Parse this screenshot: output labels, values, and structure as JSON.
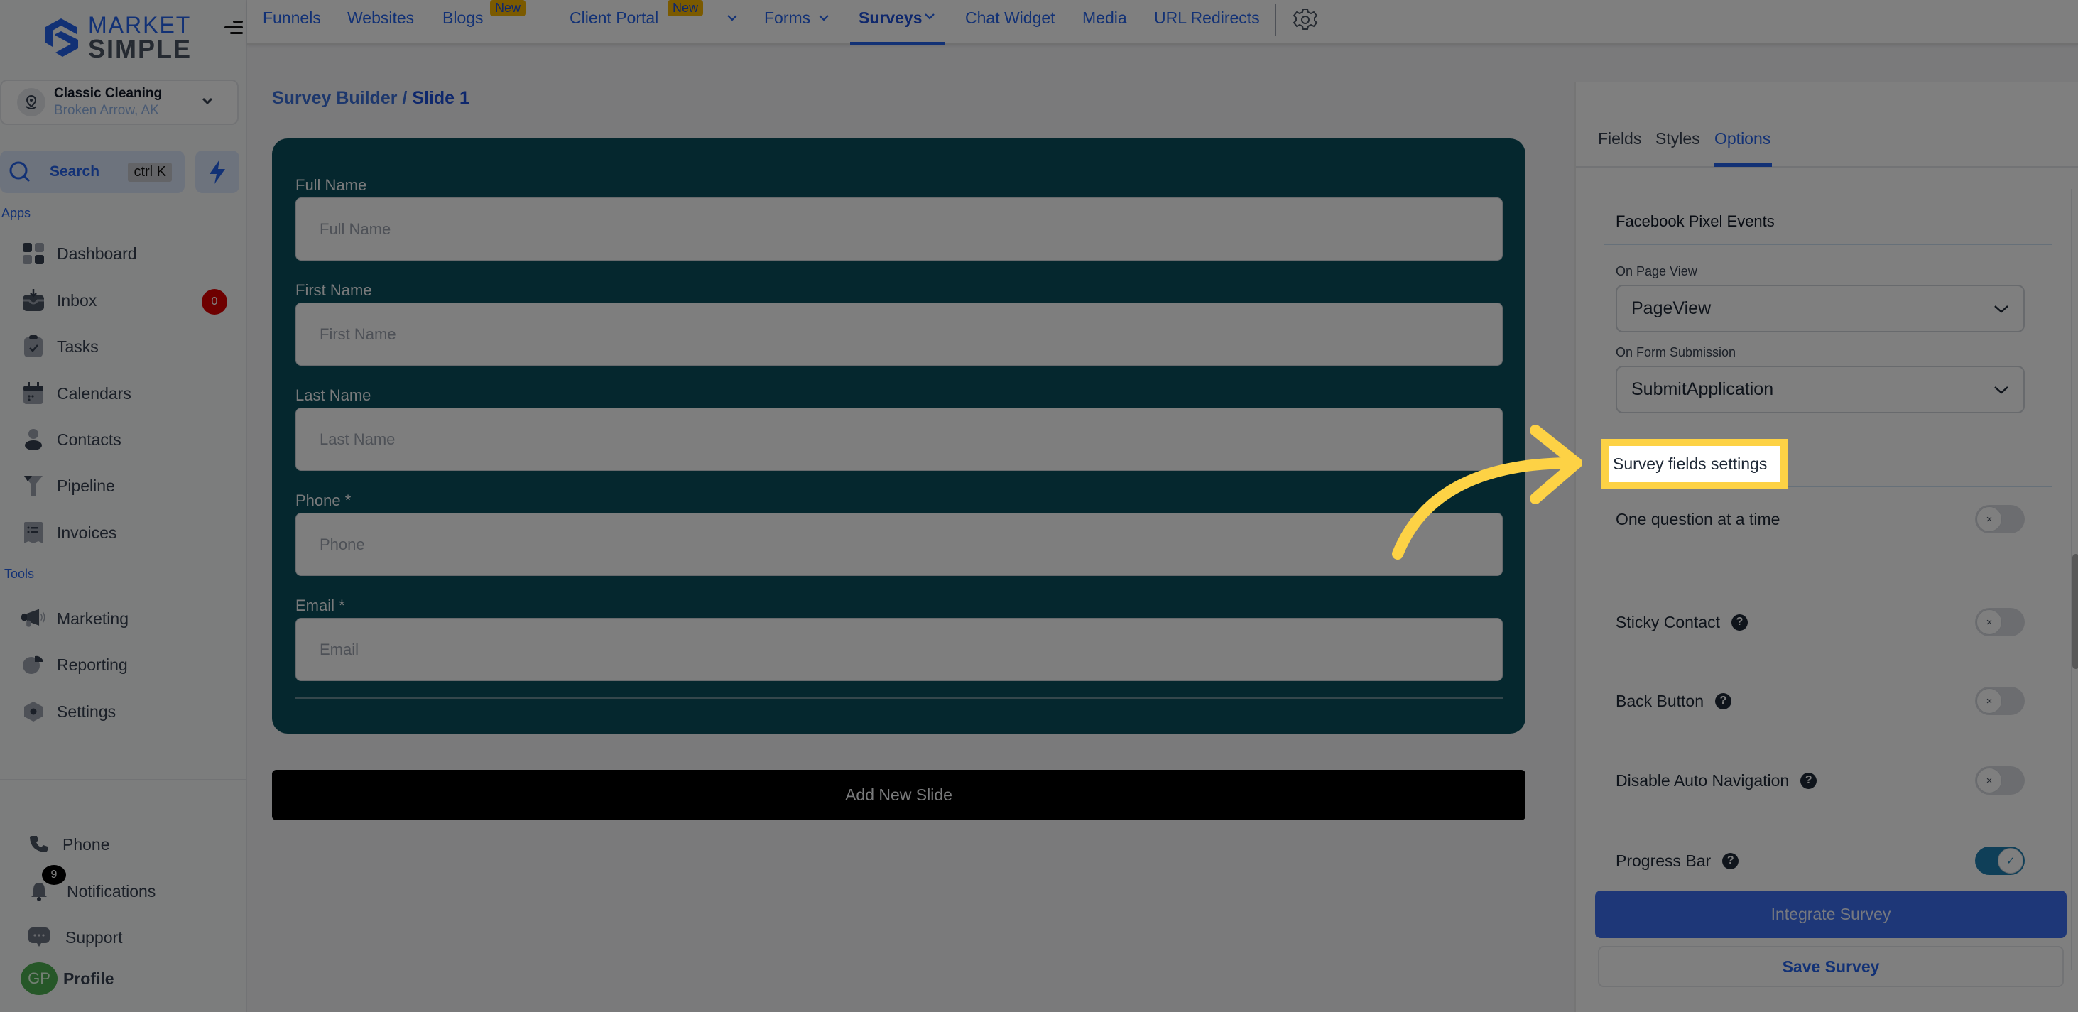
{
  "brand": {
    "line1": "MARKET",
    "line2": "SIMPLE",
    "accent": "#2563eb"
  },
  "location": {
    "name": "Classic Cleaning",
    "subtitle": "Broken Arrow, AK"
  },
  "search": {
    "label": "Search",
    "shortcut": "ctrl K"
  },
  "sidebar": {
    "apps_label": "Apps",
    "tools_label": "Tools",
    "apps": [
      {
        "label": "Dashboard",
        "icon": "dashboard-icon"
      },
      {
        "label": "Inbox",
        "icon": "inbox-icon",
        "badge": "0"
      },
      {
        "label": "Tasks",
        "icon": "tasks-icon"
      },
      {
        "label": "Calendars",
        "icon": "calendar-icon"
      },
      {
        "label": "Contacts",
        "icon": "contacts-icon"
      },
      {
        "label": "Pipeline",
        "icon": "pipeline-icon"
      },
      {
        "label": "Invoices",
        "icon": "invoices-icon"
      }
    ],
    "tools": [
      {
        "label": "Marketing",
        "icon": "megaphone-icon"
      },
      {
        "label": "Reporting",
        "icon": "pie-chart-icon"
      },
      {
        "label": "Settings",
        "icon": "settings-icon"
      }
    ],
    "bottom": {
      "phone": "Phone",
      "notifications": "Notifications",
      "notifications_badge": "9",
      "support": "Support",
      "profile": "Profile",
      "avatar_initials": "GP"
    }
  },
  "topnav": {
    "items": [
      {
        "label": "Funnels"
      },
      {
        "label": "Websites"
      },
      {
        "label": "Blogs",
        "badge": "New"
      },
      {
        "label": "Client Portal",
        "badge": "New"
      },
      {
        "label": "Forms"
      },
      {
        "label": "Surveys",
        "active": true
      },
      {
        "label": "Chat Widget"
      },
      {
        "label": "Media"
      },
      {
        "label": "URL Redirects"
      }
    ]
  },
  "breadcrumb": {
    "parent": "Survey Builder /",
    "current": "Slide 1"
  },
  "form": {
    "background": "#0b4f5c",
    "fields": [
      {
        "label": "Full Name",
        "placeholder": "Full Name"
      },
      {
        "label": "First Name",
        "placeholder": "First Name"
      },
      {
        "label": "Last Name",
        "placeholder": "Last Name"
      },
      {
        "label": "Phone *",
        "placeholder": "Phone"
      },
      {
        "label": "Email *",
        "placeholder": "Email"
      }
    ],
    "add_slide_label": "Add New Slide"
  },
  "right_panel": {
    "tabs": [
      {
        "label": "Fields"
      },
      {
        "label": "Styles"
      },
      {
        "label": "Options",
        "active": true
      }
    ],
    "pixel_section": "Facebook Pixel Events",
    "on_page_view_label": "On Page View",
    "on_page_view_value": "PageView",
    "on_submit_label": "On Form Submission",
    "on_submit_value": "SubmitApplication",
    "survey_section": "Survey fields settings",
    "options": [
      {
        "label": "One question at a time",
        "help": false,
        "enabled": false
      },
      {
        "label": "Sticky Contact",
        "help": true,
        "enabled": false
      },
      {
        "label": "Back Button",
        "help": true,
        "enabled": false
      },
      {
        "label": "Disable Auto Navigation",
        "help": true,
        "enabled": false
      },
      {
        "label": "Progress Bar",
        "help": true,
        "enabled": true
      }
    ],
    "integrate_label": "Integrate Survey",
    "save_label": "Save Survey"
  },
  "annotation": {
    "highlight_text": "Survey fields settings",
    "highlight_color": "#fdd245"
  },
  "glyphs": {
    "help": "?",
    "toggle_off": "×",
    "toggle_on": "✓"
  }
}
